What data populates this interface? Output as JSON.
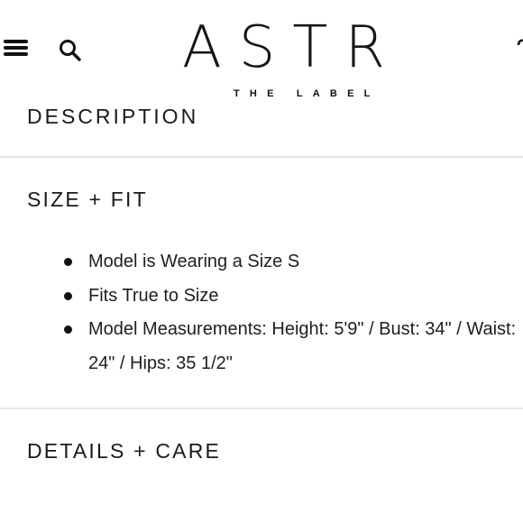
{
  "header": {
    "logo_main": "ASTR",
    "logo_sub": "THE LABEL",
    "icons": {
      "menu": "hamburger-menu-icon",
      "search": "search-icon",
      "cart": "bag-icon"
    }
  },
  "sections": {
    "description_title": "DESCRIPTION",
    "size_fit": {
      "title": "SIZE + FIT",
      "bullets": [
        "Model is Wearing a Size S",
        "Fits True to Size",
        "Model Measurements: Height: 5'9\" / Bust: 34\" / Waist: 24\" / Hips: 35 1/2\""
      ]
    },
    "details_care_title": "DETAILS + CARE"
  },
  "colors": {
    "text": "#1a1a1a",
    "divider": "#e6e6e6",
    "background": "#ffffff"
  }
}
